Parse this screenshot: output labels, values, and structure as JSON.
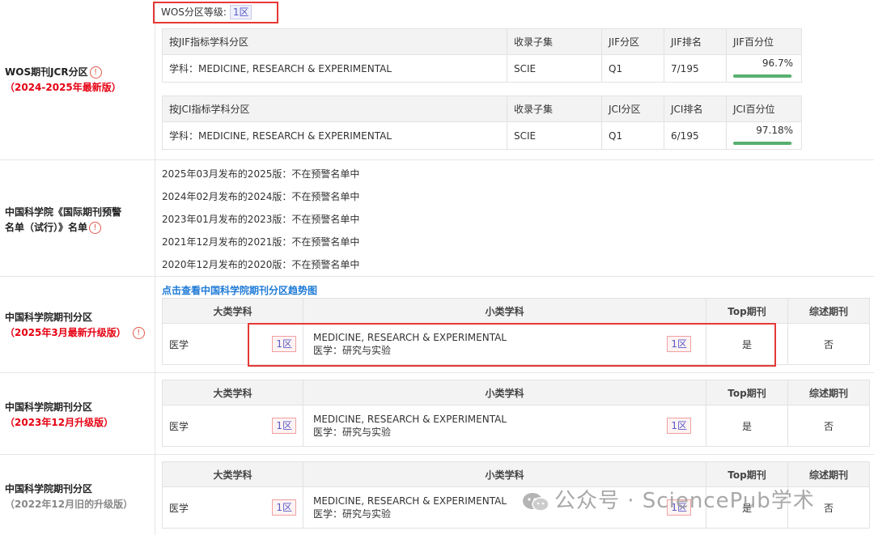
{
  "wos": {
    "grade_label": "WOS分区等级:",
    "grade_value": "1区",
    "label_line1": "WOS期刊JCR分区",
    "label_line2": "（2024-2025年最新版）",
    "jif_table": {
      "headers": [
        "按JIF指标学科分区",
        "收录子集",
        "JIF分区",
        "JIF排名",
        "JIF百分位"
      ],
      "row": {
        "subject": "学科：MEDICINE, RESEARCH & EXPERIMENTAL",
        "subset": "SCIE",
        "quartile": "Q1",
        "rank": "7/195",
        "percentile": "96.7%",
        "percentile_value": 96.7
      }
    },
    "jci_table": {
      "headers": [
        "按JCI指标学科分区",
        "收录子集",
        "JCI分区",
        "JCI排名",
        "JCI百分位"
      ],
      "row": {
        "subject": "学科：MEDICINE, RESEARCH & EXPERIMENTAL",
        "subset": "SCIE",
        "quartile": "Q1",
        "rank": "6/195",
        "percentile": "97.18%",
        "percentile_value": 97.18
      }
    }
  },
  "warning": {
    "label_line1": "中国科学院《国际期刊预警",
    "label_line2": "名单（试行）》名单",
    "items": [
      "2025年03月发布的2025版：不在预警名单中",
      "2024年02月发布的2024版：不在预警名单中",
      "2023年01月发布的2023版：不在预警名单中",
      "2021年12月发布的2021版：不在预警名单中",
      "2020年12月发布的2020版：不在预警名单中"
    ]
  },
  "cas_link": "点击查看中国科学院期刊分区趋势图",
  "cas_headers": [
    "大类学科",
    "小类学科",
    "Top期刊",
    "综述期刊"
  ],
  "cas_blocks": [
    {
      "label_line1": "中国科学院期刊分区",
      "label_line2": "（2025年3月最新升级版）",
      "major": "医学",
      "major_zone": "1区",
      "minor_en": "MEDICINE, RESEARCH & EXPERIMENTAL",
      "minor_cn": "医学：研究与实验",
      "minor_zone": "1区",
      "top": "是",
      "review": "否"
    },
    {
      "label_line1": "中国科学院期刊分区",
      "label_line2": "（2023年12月升级版）",
      "major": "医学",
      "major_zone": "1区",
      "minor_en": "MEDICINE, RESEARCH & EXPERIMENTAL",
      "minor_cn": "医学：研究与实验",
      "minor_zone": "1区",
      "top": "是",
      "review": "否"
    },
    {
      "label_line1": "中国科学院期刊分区",
      "label_line2": "（2022年12月旧的升级版）",
      "major": "医学",
      "major_zone": "1区",
      "minor_en": "MEDICINE, RESEARCH & EXPERIMENTAL",
      "minor_cn": "医学：研究与实验",
      "minor_zone": "1区",
      "top": "是",
      "review": "否"
    }
  ],
  "watermark": "公众号 · SciencePub学术",
  "colors": {
    "accent_red": "#e60012",
    "link_blue": "#1e7ad6",
    "bar_green": "#57b06f",
    "highlight_box": "#e53935"
  }
}
